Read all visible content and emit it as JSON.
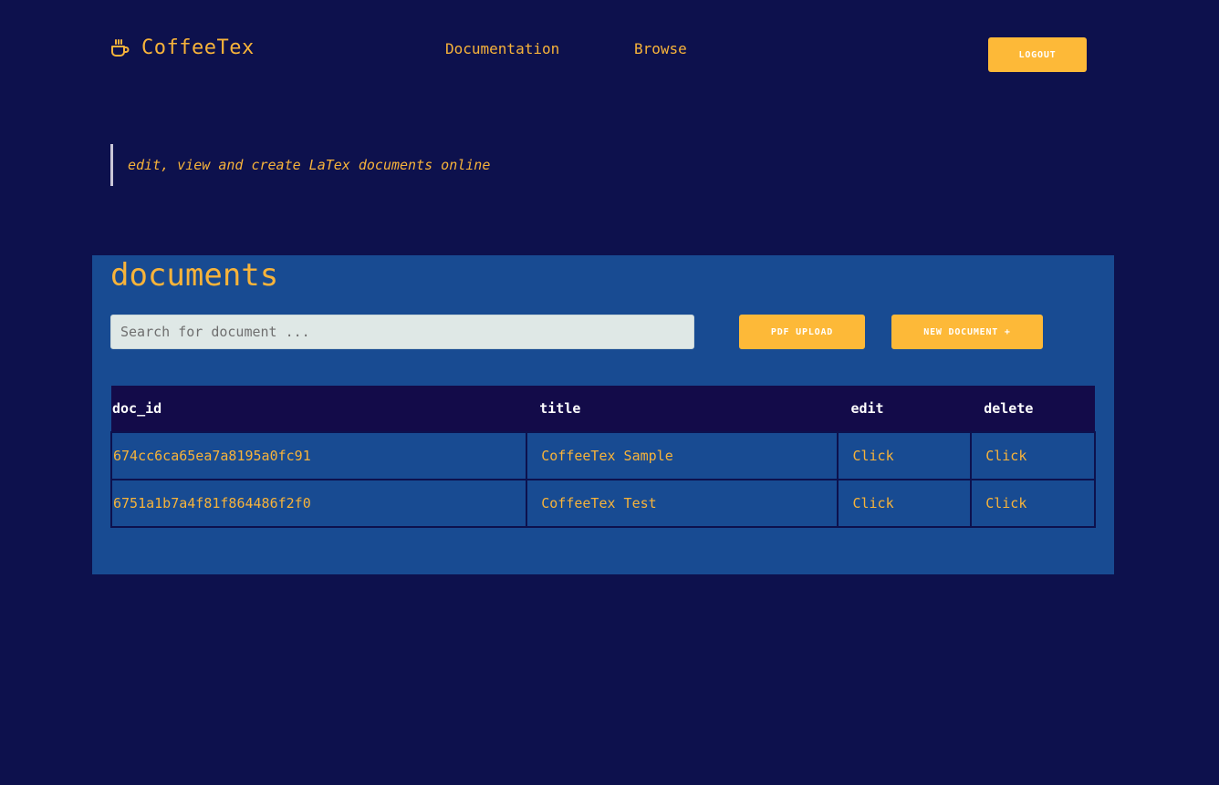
{
  "header": {
    "brand_name": "CoffeeTex",
    "brand_icon": "coffee-cup-icon",
    "nav": [
      {
        "label": "Documentation"
      },
      {
        "label": "Browse"
      }
    ],
    "logout_label": "LOGOUT"
  },
  "tagline": "edit, view and create LaTex documents online",
  "documents": {
    "title": "documents",
    "search_placeholder": "Search for document ...",
    "search_value": "",
    "pdf_upload_label": "PDF UPLOAD",
    "new_document_label": "NEW DOCUMENT +",
    "table": {
      "columns": [
        "doc_id",
        "title",
        "edit",
        "delete"
      ],
      "rows": [
        {
          "doc_id": "674cc6ca65ea7a8195a0fc91",
          "title": "CoffeeTex Sample",
          "edit": "Click",
          "delete": "Click"
        },
        {
          "doc_id": "6751a1b7a4f81f864486f2f0",
          "title": "CoffeeTex Test",
          "edit": "Click",
          "delete": "Click"
        }
      ]
    }
  },
  "colors": {
    "page_background": "#0d114d",
    "panel_background": "#184b92",
    "accent": "#f7b33a",
    "button": "#fdb938",
    "table_header": "#130b49"
  }
}
